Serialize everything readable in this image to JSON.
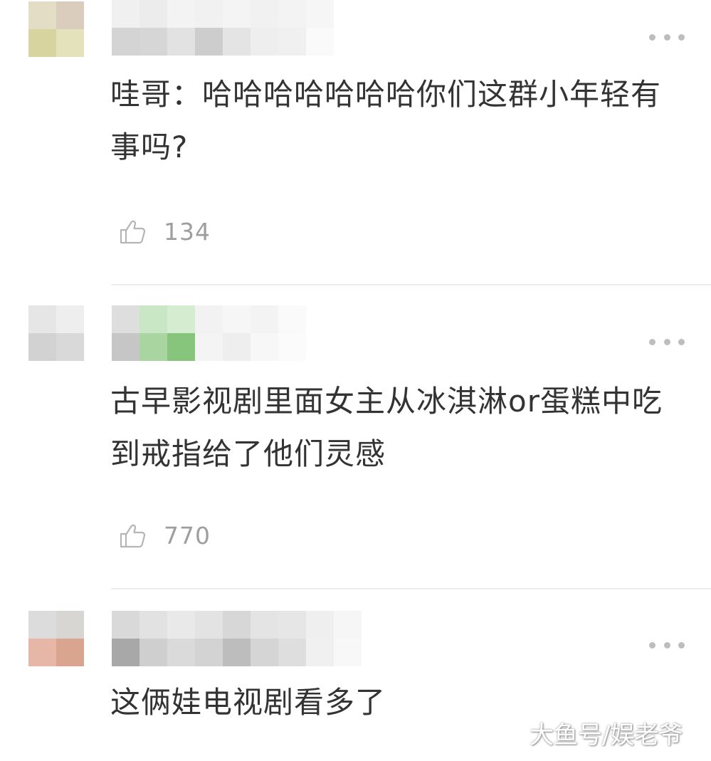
{
  "comments": [
    {
      "text": "哇哥：哈哈哈哈哈哈哈你们这群小年轻有事吗?",
      "likes": "134",
      "avatar_colors": [
        "#e4ddc4",
        "#dccdbb",
        "#d9d49b",
        "#e4e2b6"
      ],
      "name_colors": [
        "#f0f0f0",
        "#d4d4d4",
        "#ececec",
        "#d6d6d6",
        "#f3f3f3",
        "#e2e2e2",
        "#f1f1f1",
        "#cdcdcd",
        "#f4f4f4",
        "#e4e4e4",
        "#f1f1f1",
        "#eeeeee",
        "#f3f3f3",
        "#f0f0f0",
        "#f6f6f6",
        "#fafafa"
      ]
    },
    {
      "text": "古早影视剧里面女主从冰淇淋or蛋糕中吃到戒指给了他们灵感",
      "likes": "770",
      "avatar_colors": [
        "#e6e6e6",
        "#eeeeee",
        "#d2d2d2",
        "#d9d9d9"
      ],
      "name_colors": [
        "#dedede",
        "#c6c6c6",
        "#c9e7c4",
        "#a9d5a0",
        "#d5ecd0",
        "#86c57b",
        "#f2f2f2",
        "#f4f4f4",
        "#f6f6f6",
        "#eeeeee",
        "#f3f3f3",
        "#f7f7f7",
        "#fafafa",
        "#fbfbfb"
      ]
    },
    {
      "text": "这俩娃电视剧看多了",
      "likes": "",
      "avatar_colors": [
        "#dcdcdc",
        "#d8d6d2",
        "#eab5a4",
        "#dfa48a"
      ],
      "name_colors": [
        "#d9d9d9",
        "#a8a8a8",
        "#e2e2e2",
        "#cfcfcf",
        "#e9e9e9",
        "#dadada",
        "#e3e3e3",
        "#d3d3d3",
        "#d7d7d7",
        "#bdbdbd",
        "#e4e4e4",
        "#d5d5d5",
        "#e6e6e6",
        "#dedede",
        "#efefef",
        "#f0f0f0",
        "#f6f6f6",
        "#f8f8f8"
      ]
    }
  ],
  "watermark": "大鱼号/娱老爷",
  "icons": {
    "more": "more-dots-icon",
    "like": "thumbs-up-icon"
  }
}
